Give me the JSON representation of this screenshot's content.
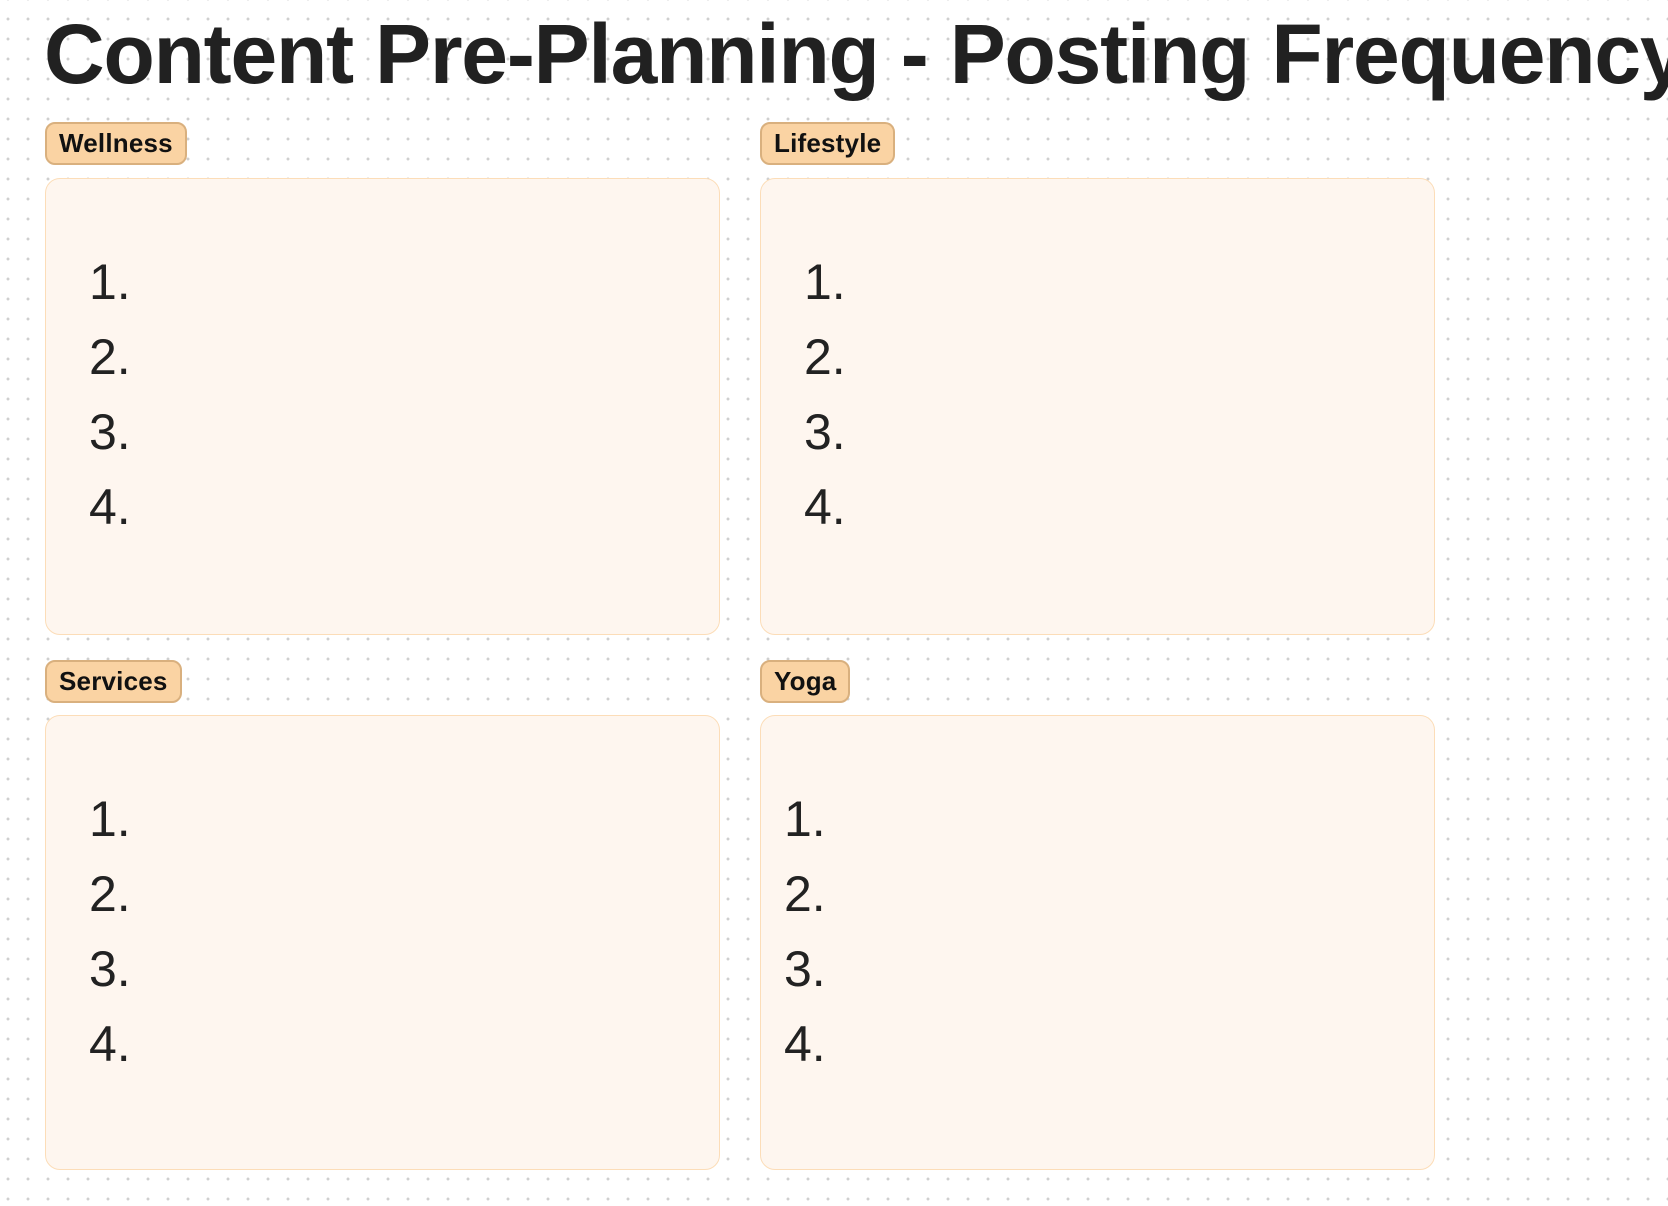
{
  "title": "Content Pre-Planning - Posting Frequency",
  "colors": {
    "background": "#ffffff",
    "grid_dot": "#cfcfcf",
    "tag_fill": "#fad3a3",
    "tag_border": "#d9b07e",
    "panel_fill": "#fef6ef",
    "panel_border": "#fcddb8",
    "text": "#212121"
  },
  "sections": [
    {
      "tag": "Wellness",
      "items": [
        {
          "number": "1.",
          "text": ""
        },
        {
          "number": "2.",
          "text": ""
        },
        {
          "number": "3.",
          "text": ""
        },
        {
          "number": "4.",
          "text": ""
        }
      ]
    },
    {
      "tag": "Lifestyle",
      "items": [
        {
          "number": "1.",
          "text": ""
        },
        {
          "number": "2.",
          "text": ""
        },
        {
          "number": "3.",
          "text": ""
        },
        {
          "number": "4.",
          "text": ""
        }
      ]
    },
    {
      "tag": "Services",
      "items": [
        {
          "number": "1.",
          "text": ""
        },
        {
          "number": "2.",
          "text": ""
        },
        {
          "number": "3.",
          "text": ""
        },
        {
          "number": "4.",
          "text": ""
        }
      ]
    },
    {
      "tag": "Yoga",
      "items": [
        {
          "number": "1.",
          "text": ""
        },
        {
          "number": "2.",
          "text": ""
        },
        {
          "number": "3.",
          "text": ""
        },
        {
          "number": "4.",
          "text": ""
        }
      ]
    }
  ]
}
